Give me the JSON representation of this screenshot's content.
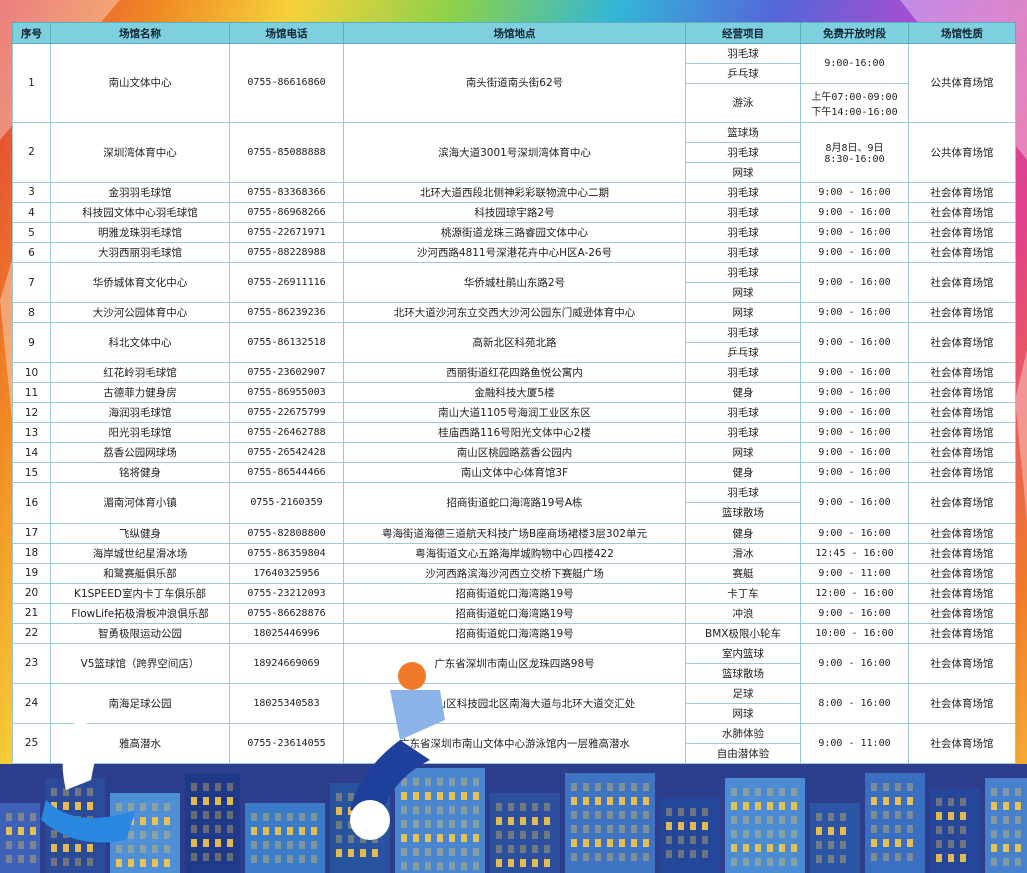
{
  "headers": [
    "序号",
    "场馆名称",
    "场馆电话",
    "场馆地点",
    "经营项目",
    "免费开放时段",
    "场馆性质"
  ],
  "rows": [
    {
      "no": "1",
      "name": "南山文体中心",
      "phone": "0755-86616860",
      "addr": "南头街道南头街62号",
      "items": [
        "羽毛球",
        "乒乓球",
        "游泳"
      ],
      "times": [
        "9:00-16:00",
        "上午07:00-09:00",
        "下午14:00-16:00"
      ],
      "type": "公共体育场馆"
    },
    {
      "no": "2",
      "name": "深圳湾体育中心",
      "phone": "0755-85088888",
      "addr": "滨海大道3001号深圳湾体育中心",
      "items": [
        "篮球场",
        "羽毛球",
        "网球"
      ],
      "times": [
        "8月8日、9日",
        "8:30-16:00"
      ],
      "type": "公共体育场馆"
    },
    {
      "no": "3",
      "name": "金羽羽毛球馆",
      "phone": "0755-83368366",
      "addr": "北环大道西段北侧神彩彩联物流中心二期",
      "items": [
        "羽毛球"
      ],
      "times": [
        "9:00 - 16:00"
      ],
      "type": "社会体育场馆"
    },
    {
      "no": "4",
      "name": "科技园文体中心羽毛球馆",
      "phone": "0755-86968266",
      "addr": "科技园琼宇路2号",
      "items": [
        "羽毛球"
      ],
      "times": [
        "9:00 - 16:00"
      ],
      "type": "社会体育场馆"
    },
    {
      "no": "5",
      "name": "明雅龙珠羽毛球馆",
      "phone": "0755-22671971",
      "addr": "桃源街道龙珠三路睿园文体中心",
      "items": [
        "羽毛球"
      ],
      "times": [
        "9:00 - 16:00"
      ],
      "type": "社会体育场馆"
    },
    {
      "no": "6",
      "name": "大羽西丽羽毛球馆",
      "phone": "0755-88228988",
      "addr": "沙河西路4811号深港花卉中心H区A-26号",
      "items": [
        "羽毛球"
      ],
      "times": [
        "9:00 - 16:00"
      ],
      "type": "社会体育场馆"
    },
    {
      "no": "7",
      "name": "华侨城体育文化中心",
      "phone": "0755-26911116",
      "addr": "华侨城杜鹃山东路2号",
      "items": [
        "羽毛球",
        "网球"
      ],
      "times": [
        "9:00 - 16:00"
      ],
      "type": "社会体育场馆"
    },
    {
      "no": "8",
      "name": "大沙河公园体育中心",
      "phone": "0755-86239236",
      "addr": "北环大道沙河东立交西大沙河公园东门威逊体育中心",
      "items": [
        "网球"
      ],
      "times": [
        "9:00 - 16:00"
      ],
      "type": "社会体育场馆"
    },
    {
      "no": "9",
      "name": "科北文体中心",
      "phone": "0755-86132518",
      "addr": "高新北区科苑北路",
      "items": [
        "羽毛球",
        "乒乓球"
      ],
      "times": [
        "9:00 - 16:00"
      ],
      "type": "社会体育场馆"
    },
    {
      "no": "10",
      "name": "红花岭羽毛球馆",
      "phone": "0755-23602907",
      "addr": "西丽街道红花四路鱼悦公寓内",
      "items": [
        "羽毛球"
      ],
      "times": [
        "9:00 - 16:00"
      ],
      "type": "社会体育场馆"
    },
    {
      "no": "11",
      "name": "古德菲力健身房",
      "phone": "0755-86955003",
      "addr": "金融科技大厦5楼",
      "items": [
        "健身"
      ],
      "times": [
        "9:00 - 16:00"
      ],
      "type": "社会体育场馆"
    },
    {
      "no": "12",
      "name": "海润羽毛球馆",
      "phone": "0755-22675799",
      "addr": "南山大道1105号海润工业区东区",
      "items": [
        "羽毛球"
      ],
      "times": [
        "9:00 - 16:00"
      ],
      "type": "社会体育场馆"
    },
    {
      "no": "13",
      "name": "阳光羽毛球馆",
      "phone": "0755-26462788",
      "addr": "桂庙西路116号阳光文体中心2楼",
      "items": [
        "羽毛球"
      ],
      "times": [
        "9:00 - 16:00"
      ],
      "type": "社会体育场馆"
    },
    {
      "no": "14",
      "name": "荔香公园网球场",
      "phone": "0755-26542428",
      "addr": "南山区桃园路荔香公园内",
      "items": [
        "网球"
      ],
      "times": [
        "9:00 - 16:00"
      ],
      "type": "社会体育场馆"
    },
    {
      "no": "15",
      "name": "铭将健身",
      "phone": "0755-86544466",
      "addr": "南山文体中心体育馆3F",
      "items": [
        "健身"
      ],
      "times": [
        "9:00 - 16:00"
      ],
      "type": "社会体育场馆"
    },
    {
      "no": "16",
      "name": "湄南河体育小镇",
      "phone": "0755-2160359",
      "addr": "招商街道蛇口海湾路19号A栋",
      "items": [
        "羽毛球",
        "篮球散场"
      ],
      "times": [
        "9:00 - 16:00"
      ],
      "type": "社会体育场馆"
    },
    {
      "no": "17",
      "name": "飞纵健身",
      "phone": "0755-82808800",
      "addr": "粤海街道海德三道航天科技广场B座商场裙楼3层302单元",
      "items": [
        "健身"
      ],
      "times": [
        "9:00 - 16:00"
      ],
      "type": "社会体育场馆"
    },
    {
      "no": "18",
      "name": "海岸城世纪星滑冰场",
      "phone": "0755-86359804",
      "addr": "粤海街道文心五路海岸城购物中心四楼422",
      "items": [
        "滑冰"
      ],
      "times": [
        "12:45 - 16:00"
      ],
      "type": "社会体育场馆"
    },
    {
      "no": "19",
      "name": "和鹭赛艇俱乐部",
      "phone": "17640325956",
      "addr": "沙河西路滨海沙河西立交桥下赛艇广场",
      "items": [
        "赛艇"
      ],
      "times": [
        "9:00 - 11:00"
      ],
      "type": "社会体育场馆"
    },
    {
      "no": "20",
      "name": "K1SPEED室内卡丁车俱乐部",
      "phone": "0755-23212093",
      "addr": "招商街道蛇口海湾路19号",
      "items": [
        "卡丁车"
      ],
      "times": [
        "12:00 - 16:00"
      ],
      "type": "社会体育场馆"
    },
    {
      "no": "21",
      "name": "FlowLife拓极滑板冲浪俱乐部",
      "phone": "0755-86628876",
      "addr": "招商街道蛇口海湾路19号",
      "items": [
        "冲浪"
      ],
      "times": [
        "9:00 - 16:00"
      ],
      "type": "社会体育场馆"
    },
    {
      "no": "22",
      "name": "智勇极限运动公园",
      "phone": "18025446996",
      "addr": "招商街道蛇口海湾路19号",
      "items": [
        "BMX极限小轮车"
      ],
      "times": [
        "10:00 - 16:00"
      ],
      "type": "社会体育场馆"
    },
    {
      "no": "23",
      "name": "V5篮球馆（跨界空间店）",
      "phone": "18924669069",
      "addr": "广东省深圳市南山区龙珠四路98号",
      "items": [
        "室内篮球",
        "篮球散场"
      ],
      "times": [
        "9:00 - 16:00"
      ],
      "type": "社会体育场馆"
    },
    {
      "no": "24",
      "name": "南海足球公园",
      "phone": "18025340583",
      "addr": "深圳市南山区科技园北区南海大道与北环大道交汇处",
      "items": [
        "足球",
        "网球"
      ],
      "times": [
        "8:00 - 16:00"
      ],
      "type": "社会体育场馆"
    },
    {
      "no": "25",
      "name": "雅高潜水",
      "phone": "0755-23614055",
      "addr": "广东省深圳市南山文体中心游泳馆内一层雅高潜水",
      "items": [
        "水肺体验",
        "自由潜体验"
      ],
      "times": [
        "9:00 - 11:00"
      ],
      "type": "社会体育场馆"
    }
  ]
}
